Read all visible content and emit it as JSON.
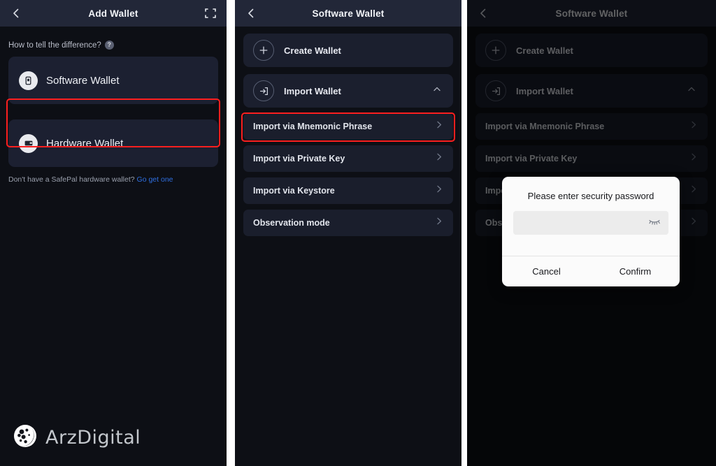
{
  "meta": {
    "accent_red": "#fc1f1f",
    "link_blue": "#2f6fe0",
    "panel_bg": "#0d0f15",
    "appbar_bg": "#222738",
    "card_bg": "#1c2031"
  },
  "panel1": {
    "appbar": {
      "title": "Add Wallet",
      "back_icon": "chevron-left-icon",
      "scan_icon": "scan-frame-icon"
    },
    "hint": {
      "text": "How to tell the difference?",
      "help_icon_label": "?"
    },
    "options": [
      {
        "label": "Software Wallet",
        "icon": "phone-wallet-icon",
        "selected": true
      },
      {
        "label": "Hardware Wallet",
        "icon": "device-wallet-icon",
        "selected": false
      }
    ],
    "footnote": {
      "text": "Don't have a SafePal hardware wallet?",
      "link": "Go get one"
    }
  },
  "panel2": {
    "appbar": {
      "title": "Software Wallet",
      "back_icon": "chevron-left-icon"
    },
    "rows": [
      {
        "label": "Create Wallet",
        "icon": "plus-icon"
      },
      {
        "label": "Import Wallet",
        "icon": "import-arrow-icon",
        "expanded": true
      }
    ],
    "sub_rows": [
      {
        "label": "Import via Mnemonic Phrase",
        "highlighted": true
      },
      {
        "label": "Import via Private Key",
        "highlighted": false
      },
      {
        "label": "Import via Keystore",
        "highlighted": false
      },
      {
        "label": "Observation mode",
        "highlighted": false
      }
    ]
  },
  "panel3": {
    "appbar": {
      "title": "Software Wallet",
      "back_icon": "chevron-left-icon"
    },
    "rows": [
      {
        "label": "Create Wallet",
        "icon": "plus-icon"
      },
      {
        "label": "Import Wallet",
        "icon": "import-arrow-icon",
        "expanded": true
      }
    ],
    "sub_rows": [
      {
        "label": "Import via Mnemonic Phrase"
      },
      {
        "label": "Import via Private Key"
      },
      {
        "label": "Import via Keystore"
      },
      {
        "label": "Observation mode"
      }
    ],
    "dialog": {
      "title": "Please enter security password",
      "password_value": "",
      "password_placeholder": "",
      "toggle_icon": "eye-closed-icon",
      "cancel_label": "Cancel",
      "confirm_label": "Confirm"
    }
  },
  "watermark": {
    "text": "ArzDigital",
    "icon": "arzdigital-logo-icon"
  }
}
